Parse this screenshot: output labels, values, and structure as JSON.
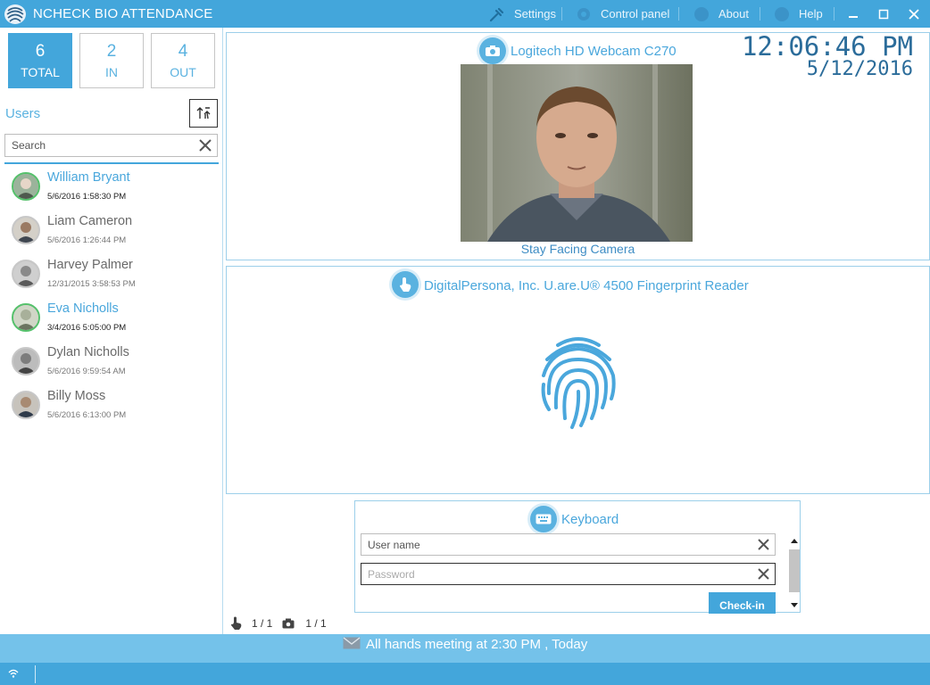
{
  "app": {
    "title": "NCHECK BIO ATTENDANCE"
  },
  "nav": {
    "settings": "Settings",
    "control_panel": "Control panel",
    "about": "About",
    "help": "Help"
  },
  "counters": [
    {
      "value": "6",
      "label": "TOTAL"
    },
    {
      "value": "2",
      "label": "IN"
    },
    {
      "value": "4",
      "label": "OUT"
    }
  ],
  "users": {
    "heading": "Users",
    "search_placeholder": "Search",
    "items": [
      {
        "name": "William Bryant",
        "time": "5/6/2016 1:58:30 PM",
        "status": "in"
      },
      {
        "name": "Liam Cameron",
        "time": "5/6/2016 1:26:44 PM",
        "status": "out"
      },
      {
        "name": "Harvey Palmer",
        "time": "12/31/2015 3:58:53 PM",
        "status": "out"
      },
      {
        "name": "Eva Nicholls",
        "time": "3/4/2016 5:05:00 PM",
        "status": "in"
      },
      {
        "name": "Dylan Nicholls",
        "time": "5/6/2016 9:59:54 AM",
        "status": "out"
      },
      {
        "name": "Billy Moss",
        "time": "5/6/2016 6:13:00 PM",
        "status": "out"
      }
    ]
  },
  "camera": {
    "device": "Logitech HD Webcam C270",
    "caption": "Stay Facing Camera"
  },
  "clock": {
    "time": "12:06:46 PM",
    "date": "5/12/2016"
  },
  "fingerprint": {
    "device": "DigitalPersona, Inc. U.are.U® 4500 Fingerprint Reader"
  },
  "keyboard": {
    "title": "Keyboard",
    "username_placeholder": "User name",
    "password_placeholder": "Password",
    "checkin_label": "Check-in"
  },
  "pager": {
    "fingerprint": "1 / 1",
    "camera": "1 / 1"
  },
  "notification": {
    "message": "All hands meeting at 2:30 PM , Today"
  },
  "colors": {
    "accent": "#43a6db",
    "in": "#55c16b",
    "notify": "#74c2ea",
    "clock": "#2b6c9a"
  }
}
